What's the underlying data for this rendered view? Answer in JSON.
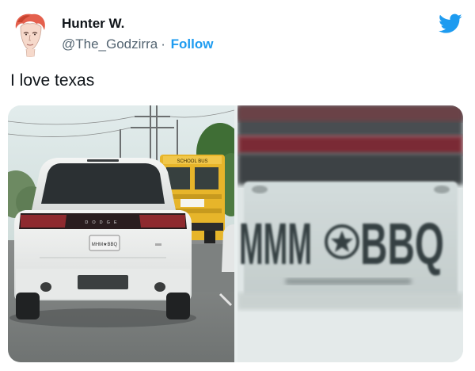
{
  "author": {
    "display_name": "Hunter W.",
    "handle": "@The_Godzirra",
    "separator": "·",
    "follow_label": "Follow",
    "avatar_icon": "profile-avatar-illustration"
  },
  "brand": {
    "icon": "twitter-bird-icon",
    "color": "#1d9bf0"
  },
  "tweet": {
    "text": "I love texas"
  },
  "media": {
    "left_photo": {
      "bus_sign": "SCHOOL BUS",
      "rear_badge": "DODGE",
      "plate_small": "MHM★BBQ"
    },
    "right_photo": {
      "plate_left": "MMM",
      "plate_right": "BBQ"
    }
  },
  "colors": {
    "text_primary": "#0f1419",
    "text_secondary": "#536471",
    "accent": "#1d9bf0"
  }
}
